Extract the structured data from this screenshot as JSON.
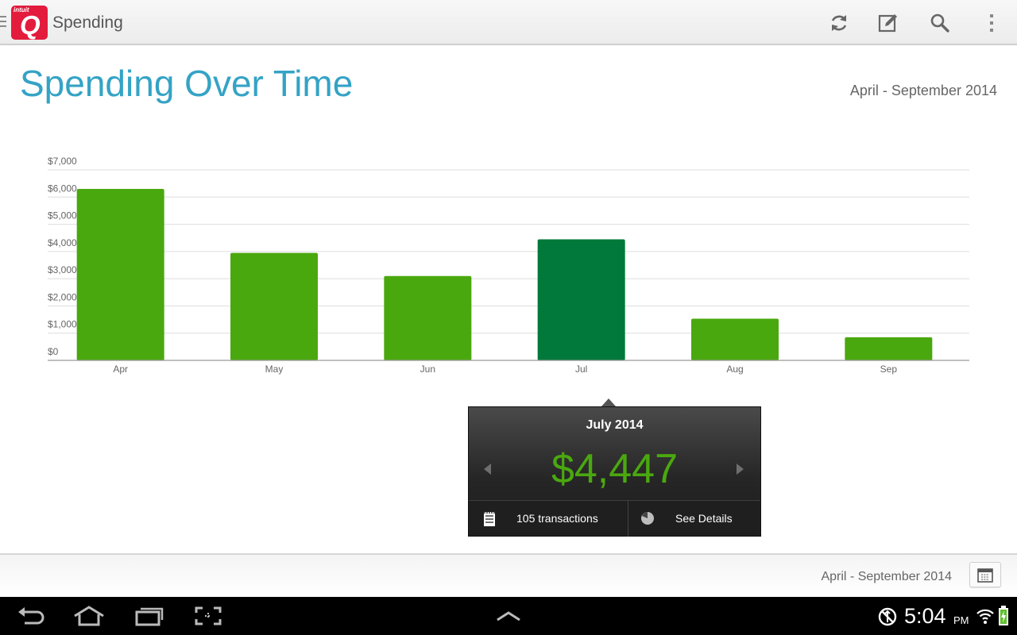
{
  "app": {
    "logo_sub": "intuit",
    "logo_letter": "Q",
    "title": "Spending"
  },
  "toolbar": {
    "icons": [
      "refresh-icon",
      "edit-icon",
      "search-icon",
      "overflow-menu-icon"
    ]
  },
  "page": {
    "title": "Spending Over Time",
    "date_range": "April - September 2014"
  },
  "chart_data": {
    "type": "bar",
    "categories": [
      "Apr",
      "May",
      "Jun",
      "Jul",
      "Aug",
      "Sep"
    ],
    "values": [
      6300,
      3950,
      3100,
      4447,
      1530,
      850
    ],
    "ylim": [
      0,
      7000
    ],
    "yticks": [
      0,
      1000,
      2000,
      3000,
      4000,
      5000,
      6000,
      7000
    ],
    "ytick_labels": [
      "$0",
      "$1,000",
      "$2,000",
      "$3,000",
      "$4,000",
      "$5,000",
      "$6,000",
      "$7,000"
    ],
    "selected_index": 3,
    "grid": true,
    "colors": {
      "bar": "#4aa80f",
      "selected": "#00793a",
      "grid": "#dddddd",
      "axis": "#999999"
    }
  },
  "tooltip": {
    "title": "July 2014",
    "amount": "$4,447",
    "transactions_label": "105 transactions",
    "details_label": "See Details"
  },
  "bottom_bar": {
    "date_range": "April - September 2014"
  },
  "system_bar": {
    "time": "5:04",
    "ampm": "PM"
  },
  "colors": {
    "title_blue": "#34a3c5",
    "amount_green": "#4aa80f",
    "brand_red": "#e31b3d"
  }
}
